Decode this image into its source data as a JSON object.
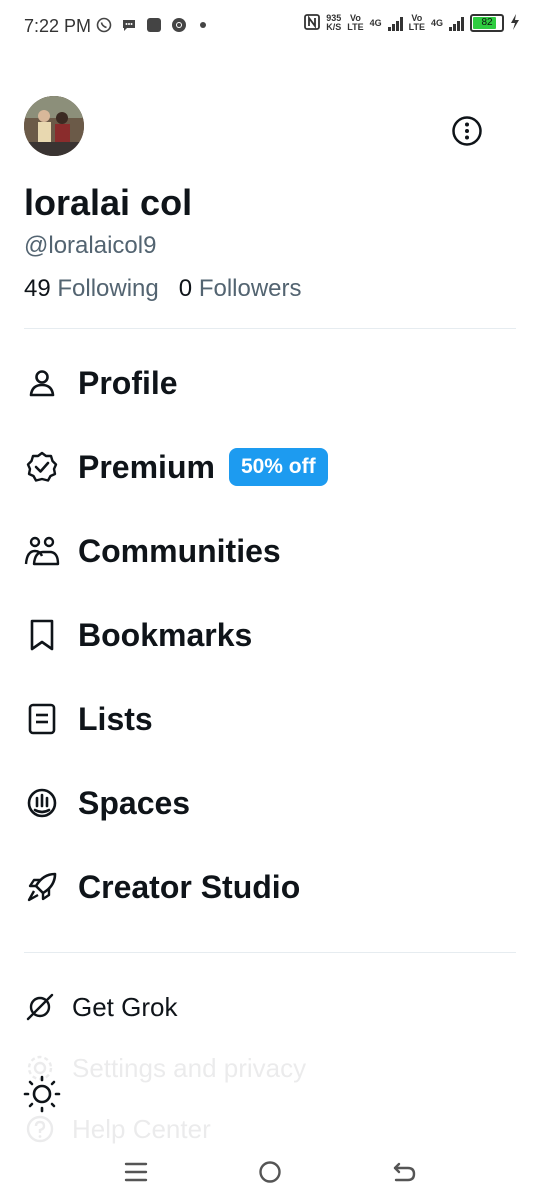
{
  "status_bar": {
    "time": "7:22 PM",
    "net_speed": "935",
    "net_unit": "K/S",
    "sim1_top": "Vo",
    "sim1_bottom": "LTE",
    "sim1_gen": "4G",
    "sim2_top": "Vo",
    "sim2_bottom": "LTE",
    "sim2_gen": "4G",
    "battery": "82",
    "battery_level": 0.82,
    "battery_color": "#2ecc40"
  },
  "profile": {
    "display_name": "loralai col",
    "handle": "@loralaicol9",
    "following_count": "49",
    "following_label": "Following",
    "followers_count": "0",
    "followers_label": "Followers"
  },
  "menu": {
    "profile": "Profile",
    "premium": "Premium",
    "premium_badge": "50% off",
    "communities": "Communities",
    "bookmarks": "Bookmarks",
    "lists": "Lists",
    "spaces": "Spaces",
    "creator_studio": "Creator Studio"
  },
  "secondary": {
    "get_grok": "Get Grok",
    "settings": "Settings and privacy",
    "help": "Help Center"
  },
  "colors": {
    "accent": "#1d9bf0",
    "text": "#0f1419",
    "muted": "#536471"
  },
  "icons": [
    "whatsapp-icon",
    "message-icon",
    "app-icon",
    "chrome-icon",
    "nfc-icon",
    "signal-icon",
    "battery-icon",
    "charging-icon",
    "avatar",
    "more-icon",
    "person-icon",
    "verified-badge-icon",
    "communities-icon",
    "bookmark-icon",
    "list-icon",
    "spaces-icon",
    "rocket-icon",
    "grok-icon",
    "gear-icon",
    "help-icon",
    "sun-icon",
    "menu-icon",
    "home-icon",
    "back-icon"
  ]
}
